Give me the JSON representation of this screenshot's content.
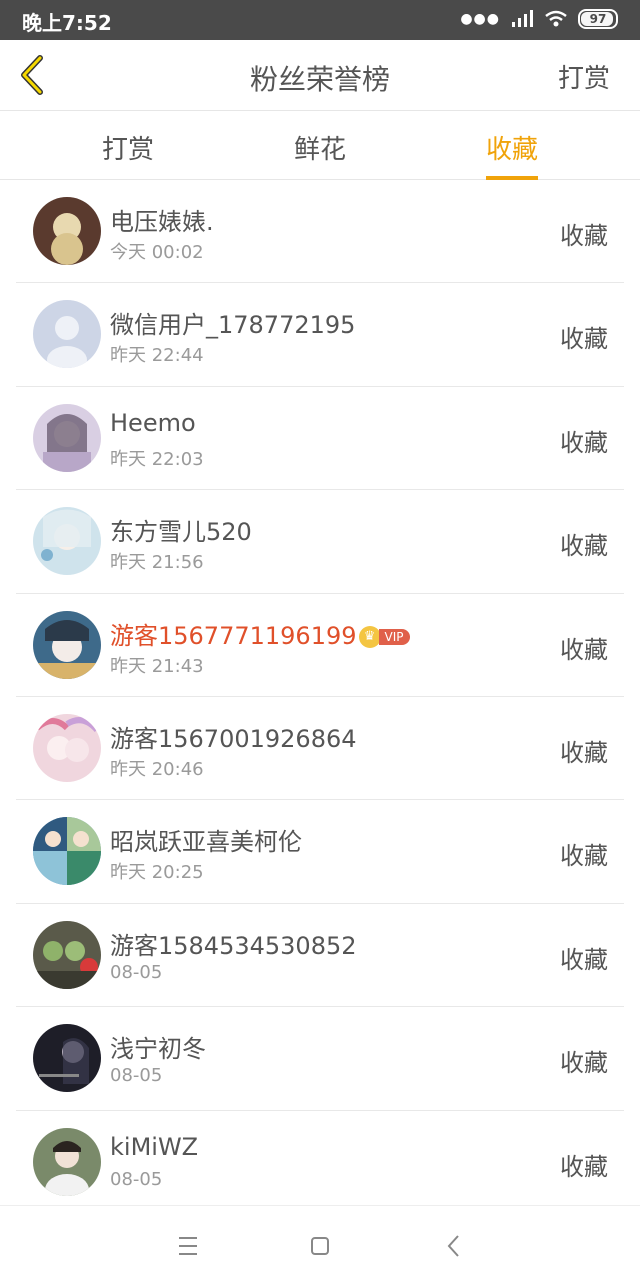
{
  "status_bar": {
    "time": "晚上7:52",
    "battery": "97"
  },
  "header": {
    "title": "粉丝荣誉榜",
    "right_action": "打赏"
  },
  "tabs": [
    {
      "label": "打赏",
      "active": false
    },
    {
      "label": "鲜花",
      "active": false
    },
    {
      "label": "收藏",
      "active": true
    }
  ],
  "colors": {
    "accent": "#f0a30a",
    "highlight_name": "#e0502a"
  },
  "list": [
    {
      "name": "电压婊婊.",
      "time": "今天 00:02",
      "action": "收藏",
      "avatar_color": "#6b4a3a"
    },
    {
      "name": "微信用户_178772195",
      "time": "昨天 22:44",
      "action": "收藏",
      "avatar_color": "#cdd5e6"
    },
    {
      "name": "Heemo",
      "time": "昨天 22:03",
      "action": "收藏",
      "avatar_color": "#b8a7c8"
    },
    {
      "name": "东方雪儿520",
      "time": "昨天 21:56",
      "action": "收藏",
      "avatar_color": "#a9c7d8"
    },
    {
      "name": "游客1567771196199",
      "time": "昨天 21:43",
      "action": "收藏",
      "avatar_color": "#3e6a8a",
      "vip": true,
      "vip_label": "VIP",
      "crown": "♛"
    },
    {
      "name": "游客1567001926864",
      "time": "昨天 20:46",
      "action": "收藏",
      "avatar_color": "#e6b7c8"
    },
    {
      "name": "昭岚跃亚喜美柯伦",
      "time": "昨天 20:25",
      "action": "收藏",
      "avatar_color": "#6aa2c8"
    },
    {
      "name": "游客1584534530852",
      "time": "08-05",
      "action": "收藏",
      "avatar_color": "#5a6a4a"
    },
    {
      "name": "浅宁初冬",
      "time": "08-05",
      "action": "收藏",
      "avatar_color": "#2a2a3a"
    },
    {
      "name": "kiMiWZ",
      "time": "08-05",
      "action": "收藏",
      "avatar_color": "#8a9a7a"
    }
  ]
}
